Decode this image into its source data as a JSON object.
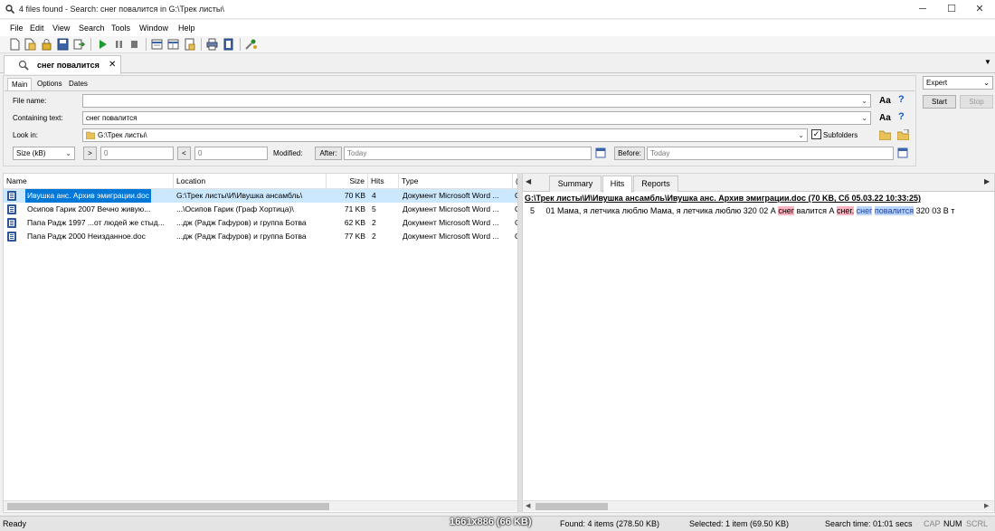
{
  "window": {
    "title": "4 files found - Search: снег повалится in G:\\Трек листы\\",
    "minimize": "─",
    "maximize": "☐",
    "close": "✕"
  },
  "menu": [
    "File",
    "Edit",
    "View",
    "Search",
    "Tools",
    "Window",
    "Help"
  ],
  "toolbar_icons": [
    "new-icon",
    "open-icon",
    "save-icon",
    "export-icon",
    "play-icon",
    "pause-icon",
    "stop-icon",
    "view-icon",
    "layout-icon",
    "report-icon",
    "print-icon",
    "properties-icon",
    "tools-icon"
  ],
  "doc_tab": {
    "label": "снег повалится",
    "close": "✕"
  },
  "search_panel": {
    "tabs": [
      "Main",
      "Options",
      "Dates"
    ],
    "file_name_label": "File name:",
    "file_name_value": "",
    "containing_label": "Containing text:",
    "containing_value": "снег повалится",
    "look_in_label": "Look in:",
    "look_in_value": "G:\\Трек листы\\",
    "subfolders_label": "Subfolders",
    "size_select": "Size (kB)",
    "gt": ">",
    "gt_value": "0",
    "lt": "<",
    "lt_value": "0",
    "modified_label": "Modified:",
    "after_label": "After:",
    "after_value": "Today",
    "before_label": "Before:",
    "before_value": "Today",
    "aa": "Aa",
    "help": "?"
  },
  "right_panel": {
    "mode": "Expert",
    "start": "Start",
    "stop": "Stop"
  },
  "results": {
    "columns": [
      "Name",
      "Location",
      "Size",
      "Hits",
      "Type",
      "("
    ],
    "rows": [
      {
        "name": "Ивушка анс. Архив эмиграции.doc",
        "location": "G:\\Трек листы\\И\\Ивушка ансамбль\\",
        "size": "70 KB",
        "hits": "4",
        "type": "Документ Microsoft Word ...",
        "extra": "C"
      },
      {
        "name": "Осипов Гарик 2007 Вечно живую...",
        "location": "...\\Осипов Гарик (Граф Хортица)\\",
        "size": "71 KB",
        "hits": "5",
        "type": "Документ Microsoft Word ...",
        "extra": "C"
      },
      {
        "name": "Папа Радж 1997 ...от людей же стыд...",
        "location": "...дж (Радж Гафуров) и группа Ботва",
        "size": "62 KB",
        "hits": "2",
        "type": "Документ Microsoft Word ...",
        "extra": "C"
      },
      {
        "name": "Папа Радж 2000 Неизданное.doc",
        "location": "...дж (Радж Гафуров) и группа Ботва",
        "size": "77 KB",
        "hits": "2",
        "type": "Документ Microsoft Word ...",
        "extra": "C"
      }
    ]
  },
  "preview": {
    "tabs": [
      "Summary",
      "Hits",
      "Reports"
    ],
    "nav_left": "◀",
    "nav_right": "▶",
    "file_header": "G:\\Трек листы\\И\\Ивушка ансамбль\\Ивушка анс. Архив эмиграции.doc   (70 KB,  Сб 05.03.22 10:33:25)",
    "hit": {
      "line_no": "5",
      "text_before": "01 Мама, я летчика люблю Мама, я летчика люблю   320  02 А ",
      "hl_a": "снег",
      "text_mid": " валится А ",
      "hl_b": "снег.",
      "space": " ",
      "hl_c": "снег",
      "space2": " ",
      "hl_d": "повалится",
      "text_after": "   320  03 В т"
    }
  },
  "status": {
    "ready": "Ready",
    "watermark": "1661x886 (66 KB)",
    "found": "Found: 4 items (278.50 KB)",
    "selected": "Selected: 1 item (69.50 KB)",
    "search_time": "Search time: 01:01 secs",
    "cap": "CAP",
    "num": "NUM",
    "scrl": "SCRL"
  }
}
